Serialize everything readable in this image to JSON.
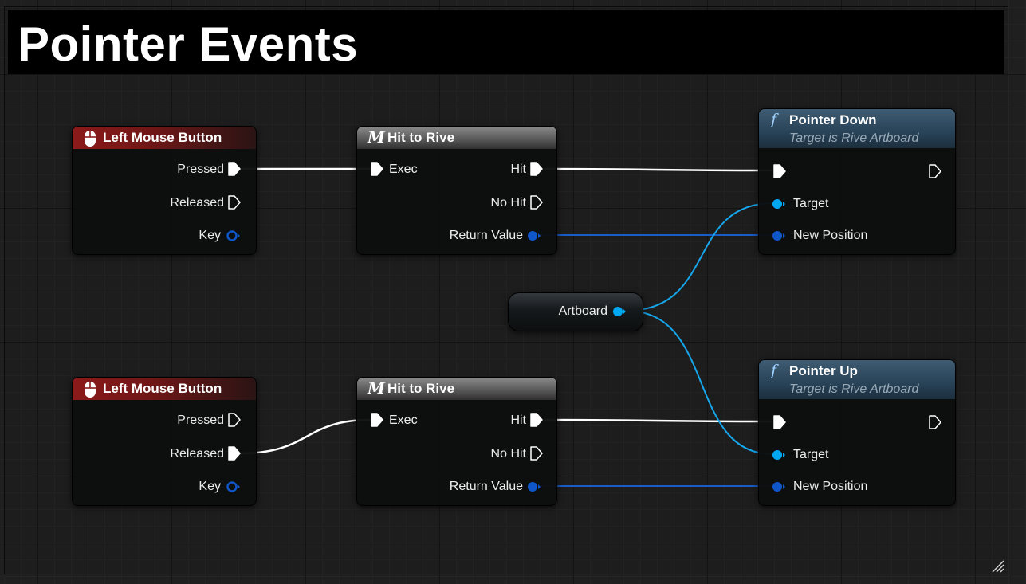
{
  "comment": {
    "title": "Pointer Events"
  },
  "colors": {
    "event_header": "#8c1a1a",
    "exec_wire": "#ffffff",
    "object_pin": "#00a8f3",
    "struct_pin": "#0f56c9"
  },
  "nodes": {
    "lmb1": {
      "title": "Left Mouse Button",
      "icon": "mouse-icon",
      "pins": {
        "pressed": "Pressed",
        "released": "Released",
        "key": "Key"
      }
    },
    "hit1": {
      "title": "Hit to Rive",
      "icon": "macro-icon",
      "glyph": "M",
      "pins": {
        "exec": "Exec",
        "hit": "Hit",
        "nohit": "No Hit",
        "retval": "Return Value"
      }
    },
    "pdown": {
      "title": "Pointer Down",
      "subtitle": "Target is Rive Artboard",
      "icon": "function-icon",
      "glyph": "f",
      "pins": {
        "target": "Target",
        "newpos": "New Position"
      }
    },
    "artboard": {
      "label": "Artboard"
    },
    "lmb2": {
      "title": "Left Mouse Button",
      "icon": "mouse-icon",
      "pins": {
        "pressed": "Pressed",
        "released": "Released",
        "key": "Key"
      }
    },
    "hit2": {
      "title": "Hit to Rive",
      "icon": "macro-icon",
      "glyph": "M",
      "pins": {
        "exec": "Exec",
        "hit": "Hit",
        "nohit": "No Hit",
        "retval": "Return Value"
      }
    },
    "pup": {
      "title": "Pointer Up",
      "subtitle": "Target is Rive Artboard",
      "icon": "function-icon",
      "glyph": "f",
      "pins": {
        "target": "Target",
        "newpos": "New Position"
      }
    }
  }
}
